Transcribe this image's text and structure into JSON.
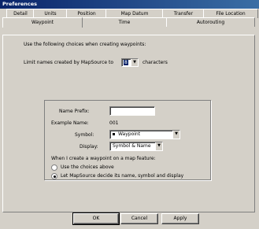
{
  "window": {
    "title": "Preferences"
  },
  "tabs_back": [
    {
      "label": "Detail"
    },
    {
      "label": "Units"
    },
    {
      "label": "Position"
    },
    {
      "label": "Map Datum"
    },
    {
      "label": "Transfer"
    },
    {
      "label": "File Location"
    }
  ],
  "tabs_front": [
    {
      "label": "Waypoint"
    },
    {
      "label": "Time"
    },
    {
      "label": "Autorouting"
    }
  ],
  "waypoint": {
    "intro": "Use the following choices when creating waypoints:",
    "limit_prefix": "Limit names created by MapSource to",
    "limit_value": "8",
    "limit_suffix": "characters",
    "name_prefix_label": "Name Prefix:",
    "name_prefix_value": "",
    "example_label": "Example Name:",
    "example_value": "001",
    "symbol_label": "Symbol:",
    "symbol_value": "Waypoint",
    "display_label": "Display:",
    "display_value": "Symbol & Name",
    "feature_label": "When I create a waypoint on a map feature:",
    "radio_choices": "Use the choices above",
    "radio_mapsource": "Let MapSource decide its name, symbol and display"
  },
  "buttons": {
    "ok": "OK",
    "cancel": "Cancel",
    "apply": "Apply"
  }
}
